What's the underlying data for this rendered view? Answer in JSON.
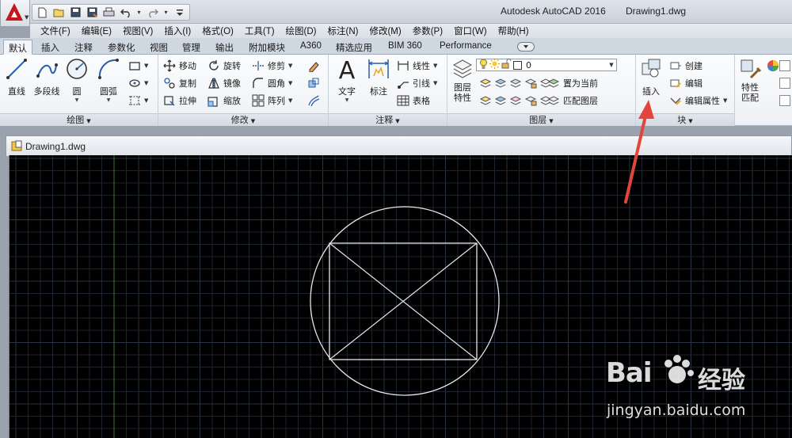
{
  "window": {
    "app_title": "Autodesk AutoCAD 2016",
    "file_title": "Drawing1.dwg"
  },
  "quick_access": {
    "icons": [
      "new-icon",
      "open-icon",
      "save-icon",
      "save-as-icon",
      "print-icon",
      "undo-icon",
      "redo-icon",
      "customize-icon"
    ]
  },
  "menu": {
    "items": [
      "文件(F)",
      "编辑(E)",
      "视图(V)",
      "插入(I)",
      "格式(O)",
      "工具(T)",
      "绘图(D)",
      "标注(N)",
      "修改(M)",
      "参数(P)",
      "窗口(W)",
      "帮助(H)"
    ]
  },
  "ribbon_tabs": {
    "items": [
      "默认",
      "插入",
      "注释",
      "参数化",
      "视图",
      "管理",
      "输出",
      "附加模块",
      "A360",
      "精选应用",
      "BIM 360",
      "Performance"
    ],
    "active": "默认"
  },
  "panels": {
    "draw": {
      "title": "绘图",
      "line": "直线",
      "polyline": "多段线",
      "circle": "圆",
      "arc": "圆弧"
    },
    "modify": {
      "title": "修改",
      "move": "移动",
      "rotate": "旋转",
      "trim": "修剪",
      "copy": "复制",
      "mirror": "镜像",
      "fillet": "圆角",
      "stretch": "拉伸",
      "scale": "缩放",
      "array": "阵列"
    },
    "annotation": {
      "title": "注释",
      "text": "文字",
      "dimension": "标注",
      "linear": "线性",
      "leader": "引线",
      "table": "表格"
    },
    "layers": {
      "title": "图层",
      "properties_line1": "图层",
      "properties_line2": "特性",
      "current_layer": "0",
      "set_current": "置为当前",
      "match_layer": "匹配图层"
    },
    "block": {
      "title": "块",
      "insert": "插入",
      "create": "创建",
      "edit": "编辑",
      "edit_attributes": "编辑属性"
    },
    "properties": {
      "match_line1": "特性",
      "match_line2": "匹配"
    }
  },
  "document": {
    "tab_label": "Drawing1.dwg"
  },
  "colors": {
    "canvas_bg": "#000000",
    "grid_minor": "#1c2430",
    "grid_major": "#2a3442",
    "axis_green": "#2f7a2f",
    "geometry": "#e6e6e6",
    "annotation_arrow": "#e2453a"
  },
  "watermark": {
    "brand": "Bai",
    "brand_cn": "经验",
    "url": "jingyan.baidu.com"
  }
}
